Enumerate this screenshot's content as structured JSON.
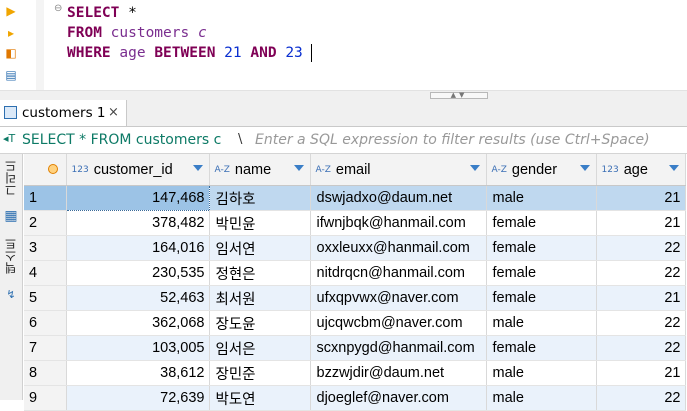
{
  "editor": {
    "lines": [
      {
        "kw1": "SELECT",
        "rest": " *"
      },
      {
        "kw1": "FROM",
        "table": "customers",
        "alias": "c"
      },
      {
        "kw1": "WHERE",
        "col": "age",
        "kw2": "BETWEEN",
        "n1": "21",
        "kw3": "AND",
        "n2": "23"
      }
    ]
  },
  "results_tab": {
    "label": "customers 1",
    "close": "×"
  },
  "filter": {
    "query": "SELECT * FROM customers c",
    "separator": "\\",
    "placeholder": "Enter a SQL expression to filter results (use Ctrl+Space)"
  },
  "side_tabs": {
    "grid": "그리드",
    "text": "텍스트"
  },
  "grid": {
    "columns": [
      {
        "type": "123",
        "label": "customer_id"
      },
      {
        "type": "A-Z",
        "label": "name"
      },
      {
        "type": "A-Z",
        "label": "email"
      },
      {
        "type": "A-Z",
        "label": "gender"
      },
      {
        "type": "123",
        "label": "age"
      }
    ],
    "rows": [
      {
        "n": "1",
        "id": "147,468",
        "name": "김하호",
        "email": "dswjadxo@daum.net",
        "gender": "male",
        "age": "21"
      },
      {
        "n": "2",
        "id": "378,482",
        "name": "박민윤",
        "email": "ifwnjbqk@hanmail.com",
        "gender": "female",
        "age": "21"
      },
      {
        "n": "3",
        "id": "164,016",
        "name": "임서연",
        "email": "oxxleuxx@hanmail.com",
        "gender": "female",
        "age": "22"
      },
      {
        "n": "4",
        "id": "230,535",
        "name": "정현은",
        "email": "nitdrqcn@hanmail.com",
        "gender": "female",
        "age": "22"
      },
      {
        "n": "5",
        "id": "52,463",
        "name": "최서원",
        "email": "ufxqpvwx@naver.com",
        "gender": "female",
        "age": "21"
      },
      {
        "n": "6",
        "id": "362,068",
        "name": "장도윤",
        "email": "ujcqwcbm@naver.com",
        "gender": "male",
        "age": "22"
      },
      {
        "n": "7",
        "id": "103,005",
        "name": "임서은",
        "email": "scxnpygd@hanmail.com",
        "gender": "female",
        "age": "22"
      },
      {
        "n": "8",
        "id": "38,612",
        "name": "장민준",
        "email": "bzzwjdir@daum.net",
        "gender": "male",
        "age": "21"
      },
      {
        "n": "9",
        "id": "72,639",
        "name": "박도연",
        "email": "djoeglef@naver.com",
        "gender": "male",
        "age": "22"
      }
    ]
  }
}
